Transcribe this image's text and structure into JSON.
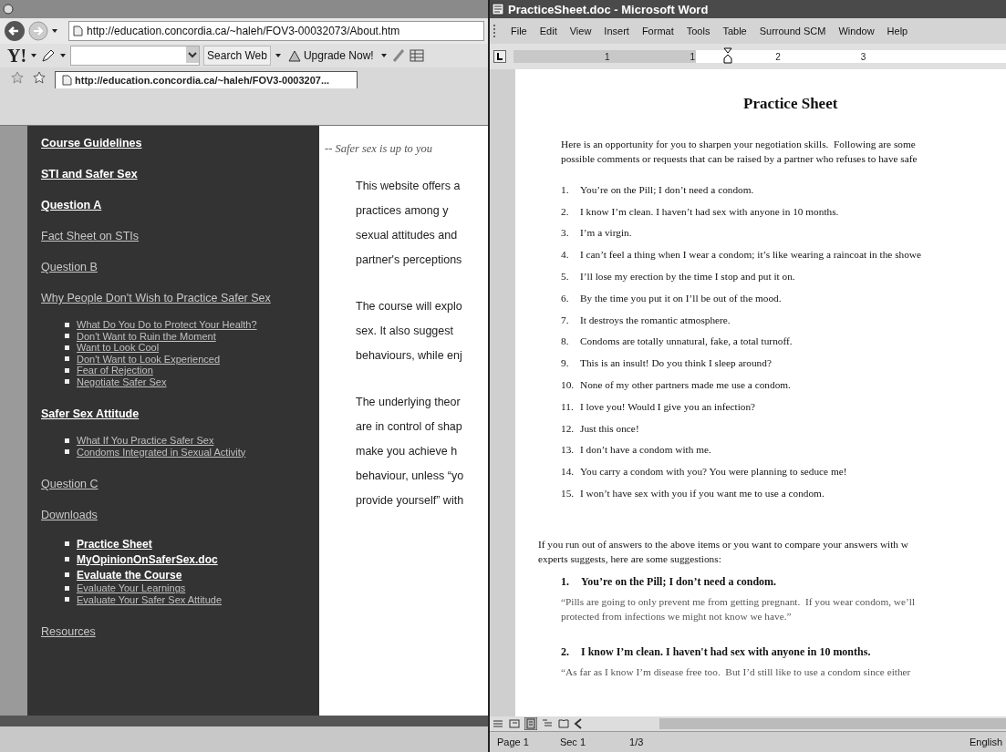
{
  "browser": {
    "address": "http://education.concordia.ca/~haleh/FOV3-00032073/About.htm",
    "toolbar": {
      "logo": "Y!",
      "search_button": "Search Web",
      "upgrade_button": "Upgrade Now!"
    },
    "tab": {
      "label": "http://education.concordia.ca/~haleh/FOV3-0003207...",
      "selected": true
    },
    "sidebar": [
      {
        "label": "Course Guidelines",
        "highlighted": true
      },
      {
        "label": "STI and Safer Sex",
        "highlighted": true
      },
      {
        "label": "Question A",
        "highlighted": true
      },
      {
        "label": "Fact Sheet on STIs",
        "highlighted": false
      },
      {
        "label": "Question B",
        "highlighted": false
      },
      {
        "label": "Why People Don't Wish to Practice Safer Sex",
        "highlighted": false,
        "children": [
          {
            "label": "What Do You Do to Protect Your Health?",
            "highlighted": false
          },
          {
            "label": "Don't Want to Ruin the Moment",
            "highlighted": false
          },
          {
            "label": "Want to Look Cool",
            "highlighted": false
          },
          {
            "label": "Don't Want to Look Experienced",
            "highlighted": false
          },
          {
            "label": "Fear of Rejection",
            "highlighted": false
          },
          {
            "label": "Negotiate Safer Sex",
            "highlighted": false
          }
        ]
      },
      {
        "label": "Safer Sex Attitude",
        "highlighted": true,
        "children": [
          {
            "label": "What If You Practice Safer Sex",
            "highlighted": false
          },
          {
            "label": "Condoms Integrated in Sexual Activity",
            "highlighted": false
          }
        ]
      },
      {
        "label": "Question C",
        "highlighted": false
      },
      {
        "label": "Downloads",
        "highlighted": false,
        "children": [
          {
            "label": "Practice Sheet",
            "highlighted": true
          },
          {
            "label": "MyOpinionOnSaferSex.doc",
            "highlighted": true
          },
          {
            "label": "Evaluate the Course",
            "highlighted": true
          },
          {
            "label": "Evaluate Your Learnings",
            "highlighted": false
          },
          {
            "label": "Evaluate Your Safer Sex Attitude",
            "highlighted": false
          }
        ]
      },
      {
        "label": "Resources",
        "highlighted": false
      }
    ],
    "content": {
      "tagline": "-- Safer sex is up to you",
      "paragraphs": [
        [
          "This website offers a",
          "practices among y",
          "sexual attitudes and",
          "partner's perceptions"
        ],
        [
          "The course will explo",
          "sex. It also suggest",
          "behaviours, while enj"
        ],
        [
          "The underlying theor",
          "are in control of shap",
          "make you achieve h",
          "behaviour, unless “yo",
          "provide yourself” with"
        ]
      ]
    }
  },
  "word": {
    "title": "PracticeSheet.doc - Microsoft Word",
    "menu": [
      "File",
      "Edit",
      "View",
      "Insert",
      "Format",
      "Tools",
      "Table",
      "Surround SCM",
      "Window",
      "Help"
    ],
    "ruler_numbers": [
      "1",
      "1",
      "2",
      "3"
    ],
    "document": {
      "title": "Practice Sheet",
      "intro": [
        "Here is an opportunity for you to sharpen your negotiation skills.  Following are some",
        "possible comments or requests that can be raised by a partner who refuses to have safe"
      ],
      "items": [
        {
          "number": "1.",
          "text": "You’re on the Pill; I don’t need a condom."
        },
        {
          "number": "2.",
          "text": "I know I’m clean. I haven’t had sex with anyone in 10 months."
        },
        {
          "number": "3.",
          "text": "I’m a virgin."
        },
        {
          "number": "4.",
          "text": "I can’t feel a thing when I wear a condom; it’s like wearing a raincoat in the showe"
        },
        {
          "number": "5.",
          "text": "I’ll lose my erection by the time I stop and put it on."
        },
        {
          "number": "6.",
          "text": "By the time you put it on I’ll be out of the mood."
        },
        {
          "number": "7.",
          "text": "It destroys the romantic atmosphere."
        },
        {
          "number": "8.",
          "text": "Condoms are totally unnatural, fake, a total turnoff."
        },
        {
          "number": "9.",
          "text": "This is an insult! Do you think I sleep around?"
        },
        {
          "number": "10.",
          "text": "None of my other partners made me use a condom."
        },
        {
          "number": "11.",
          "text": "I love you! Would I give you an infection?"
        },
        {
          "number": "12.",
          "text": "Just this once!"
        },
        {
          "number": "13.",
          "text": "I don’t have a condom with me."
        },
        {
          "number": "14.",
          "text": "You carry a condom with you? You were planning to seduce me!"
        },
        {
          "number": "15.",
          "text": "I won’t have sex with you if you want me to use a condom."
        }
      ],
      "suggestions_intro": [
        "If you run out of answers to the above items or you want to compare your answers with w",
        "experts suggests, here are some suggestions:"
      ],
      "suggestions": [
        {
          "number": "1.",
          "heading": "You’re on the Pill; I don’t need a condom.",
          "quote": [
            "“Pills are going to only prevent me from getting pregnant.  If you wear condom, we’ll",
            "protected from infections we might not know we have.”"
          ]
        },
        {
          "number": "2.",
          "heading": "I know I’m clean. I haven't had sex with anyone in 10 months.",
          "quote": [
            "“As far as I know I’m disease free too.  But I’d still like to use a condom since either"
          ]
        }
      ]
    },
    "view_buttons": [
      {
        "selected": false
      },
      {
        "selected": false
      },
      {
        "selected": true
      },
      {
        "selected": false
      },
      {
        "selected": false
      }
    ],
    "status_bar": [
      "Page 1",
      "Sec 1",
      "1/3",
      "English"
    ]
  }
}
